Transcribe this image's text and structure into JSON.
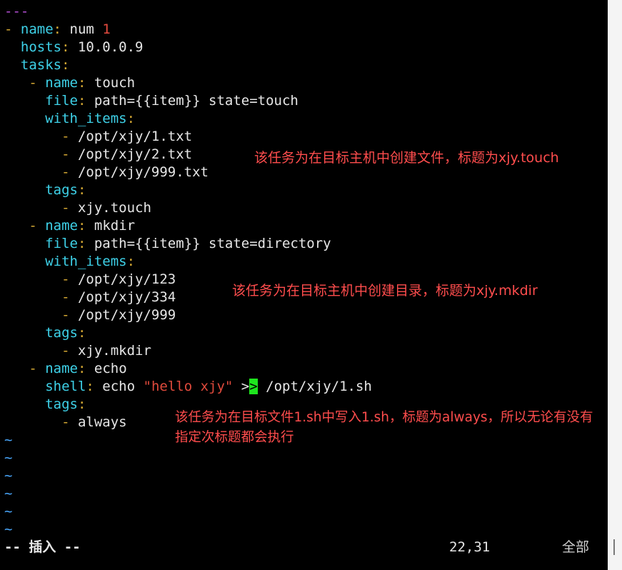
{
  "lines": {
    "doc_start": "---",
    "l2": {
      "dash": "- ",
      "key": "name",
      "colon": ":",
      "val": " num ",
      "num": "1"
    },
    "l3": {
      "key": "hosts",
      "colon": ":",
      "val": " 10.0.0.9"
    },
    "l4": {
      "key": "tasks",
      "colon": ":"
    },
    "l5": {
      "dash": "- ",
      "key": "name",
      "colon": ":",
      "val": " touch"
    },
    "l6": {
      "key": "file",
      "colon": ":",
      "val": " path={{item}} state=touch"
    },
    "l7": {
      "key": "with_items",
      "colon": ":"
    },
    "l8": {
      "dash": "- ",
      "val": "/opt/xjy/1.txt"
    },
    "l9": {
      "dash": "- ",
      "val": "/opt/xjy/2.txt"
    },
    "l10": {
      "dash": "- ",
      "val": "/opt/xjy/999.txt"
    },
    "l11": {
      "key": "tags",
      "colon": ":"
    },
    "l12": {
      "dash": "- ",
      "val": "xjy.touch"
    },
    "l13": {
      "dash": "- ",
      "key": "name",
      "colon": ":",
      "val": " mkdir"
    },
    "l14": {
      "key": "file",
      "colon": ":",
      "val": " path={{item}} state=directory"
    },
    "l15": {
      "key": "with_items",
      "colon": ":"
    },
    "l16": {
      "dash": "- ",
      "val": "/opt/xjy/123"
    },
    "l17": {
      "dash": "- ",
      "val": "/opt/xjy/334"
    },
    "l18": {
      "dash": "- ",
      "val": "/opt/xjy/999"
    },
    "l19": {
      "key": "tags",
      "colon": ":"
    },
    "l20": {
      "dash": "- ",
      "val": "xjy.mkdir"
    },
    "l21": {
      "dash": "- ",
      "key": "name",
      "colon": ":",
      "val": " echo"
    },
    "l22": {
      "key": "shell",
      "colon": ":",
      "val": " echo ",
      "str": "\"hello xjy\"",
      "pre": " >",
      "cursor": ">",
      "post": " /opt/xjy/1.sh"
    },
    "l23": {
      "key": "tags",
      "colon": ":"
    },
    "l24": {
      "dash": "- ",
      "val": "always"
    },
    "tilde": "~"
  },
  "annotations": {
    "touch": "该任务为在目标主机中创建文件，标题为xjy.touch",
    "mkdir": "该任务为在目标主机中创建目录，标题为xjy.mkdir",
    "echo_1": "该任务为在目标文件1.sh中写入1.sh，标题为always，所以无论有没有",
    "echo_2": "指定次标题都会执行"
  },
  "status": {
    "mode": "-- 插入 --",
    "position": "22,31",
    "scroll": "全部"
  },
  "colors": {
    "background": "#000000",
    "key": "#3ed1e8",
    "dash": "#d5a833",
    "number": "#e54b3f",
    "string": "#e04a3c",
    "doc_marker": "#b44fd6",
    "tilde": "#4aa9ff",
    "cursor": "#1ee51e",
    "annotation": "#ff4d4d"
  }
}
